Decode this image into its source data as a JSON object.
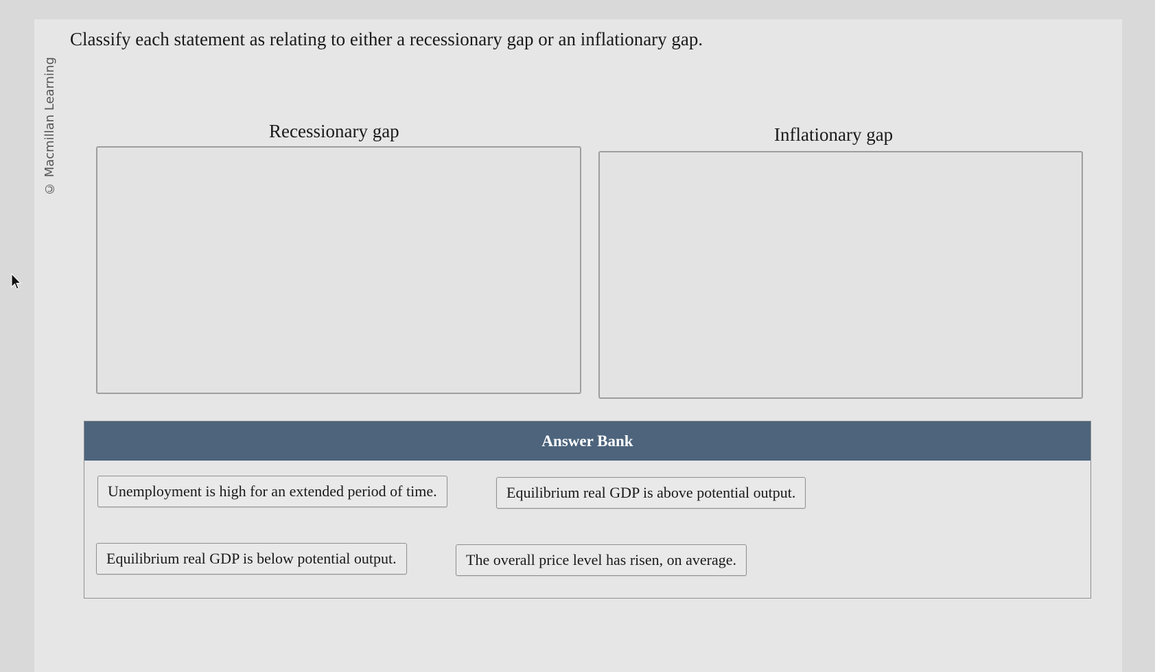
{
  "copyright": "© Macmillan Learning",
  "prompt": "Classify each statement as relating to either a recessionary gap or an inflationary gap.",
  "columns": [
    {
      "label": "Recessionary gap"
    },
    {
      "label": "Inflationary gap"
    }
  ],
  "answer_bank": {
    "title": "Answer Bank",
    "items": [
      "Unemployment is high for an extended period of time.",
      "Equilibrium real GDP is above potential output.",
      "Equilibrium real GDP is below potential output.",
      "The overall price level has risen, on average."
    ]
  },
  "colors": {
    "header_bg": "#4d647c",
    "page_bg": "#e6e6e7"
  },
  "icons": {
    "cursor": "mouse-pointer-icon"
  }
}
